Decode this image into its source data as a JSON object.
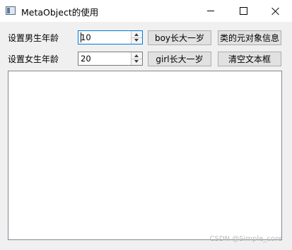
{
  "window": {
    "title": "MetaObject的使用",
    "icon": "app-window-icon"
  },
  "form": {
    "boy_age_label": "设置男生年龄",
    "girl_age_label": "设置女生年龄",
    "boy_age_value": "10",
    "girl_age_value": "20",
    "boy_grow_button": "boy长大一岁",
    "girl_grow_button": "girl长大一岁",
    "class_meta_button": "类的元对象信息",
    "clear_text_button": "清空文本框"
  },
  "output": {
    "text": ""
  },
  "watermark": "CSDN @Simple_core"
}
